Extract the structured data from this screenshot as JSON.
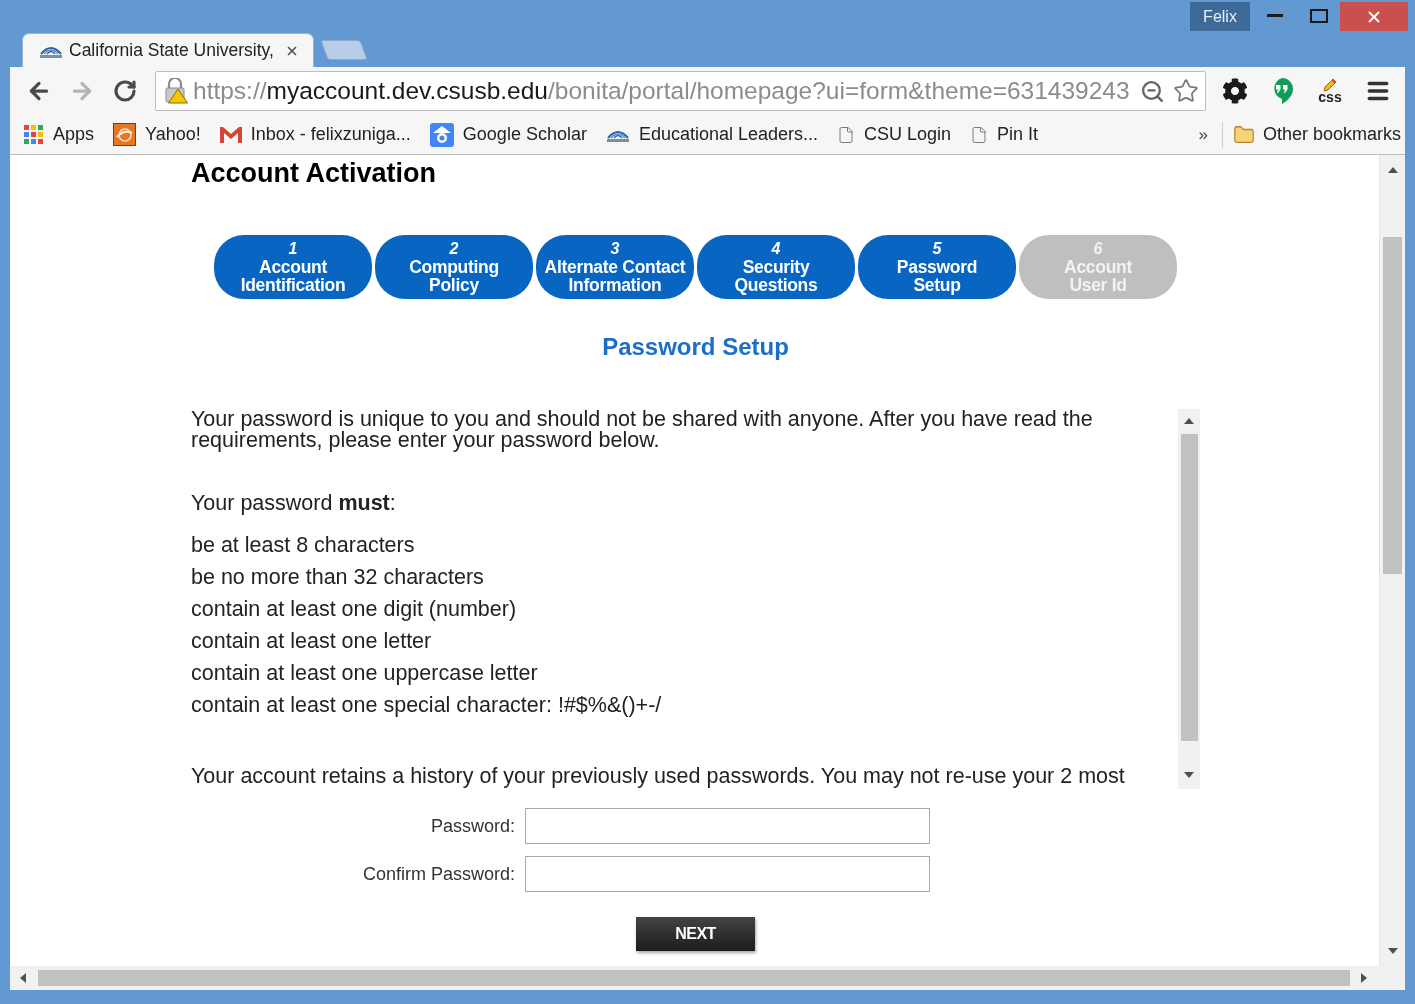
{
  "window": {
    "profile": "Felix"
  },
  "tabs": [
    {
      "title": "California State University,",
      "selected": true
    }
  ],
  "toolbar": {
    "url": {
      "scheme": "https://",
      "host": "myaccount.dev.csusb.edu",
      "path": "/bonita/portal/homepage?ui=form&theme=631439243"
    },
    "extension_label": "css"
  },
  "bookmarks": {
    "items": [
      {
        "kind": "apps",
        "label": "Apps"
      },
      {
        "kind": "yahoo",
        "label": "Yahoo!"
      },
      {
        "kind": "mail",
        "label": "Inbox - felixzuniga..."
      },
      {
        "kind": "scholar",
        "label": "Google Scholar"
      },
      {
        "kind": "campus",
        "label": "Educational Leaders..."
      },
      {
        "kind": "page",
        "label": "CSU Login"
      },
      {
        "kind": "page",
        "label": "Pin It"
      }
    ],
    "overflow": "»",
    "other": "Other bookmarks"
  },
  "page": {
    "title": "Account Activation",
    "steps": [
      {
        "number": "1",
        "lines": [
          "Account",
          "Identification"
        ],
        "disabled": false
      },
      {
        "number": "2",
        "lines": [
          "Computing",
          "Policy"
        ],
        "disabled": false
      },
      {
        "number": "3",
        "lines": [
          "Alternate Contact",
          "Information"
        ],
        "disabled": false
      },
      {
        "number": "4",
        "lines": [
          "Security",
          "Questions"
        ],
        "disabled": false
      },
      {
        "number": "5",
        "lines": [
          "Password",
          "Setup"
        ],
        "disabled": false
      },
      {
        "number": "6",
        "lines": [
          "Account",
          "User Id"
        ],
        "disabled": true
      }
    ],
    "section_title": "Password Setup",
    "intro": "Your password is unique to you and should not be shared with anyone. After you have read the requirements, please enter your password below.",
    "requirements_heading": "Your password **must**:",
    "requirements": [
      "be at least 8 characters",
      "be no more than 32 characters",
      "contain at least one digit (number)",
      "contain at least one letter",
      "contain at least one uppercase letter",
      "contain at least one special character: !#$%&()+-/"
    ],
    "history_note": "Your account retains a history of your previously used passwords. You may not re-use your 2 most",
    "fields": [
      {
        "label": "Password:"
      },
      {
        "label": "Confirm Password:"
      }
    ],
    "next_button": "NEXT"
  }
}
